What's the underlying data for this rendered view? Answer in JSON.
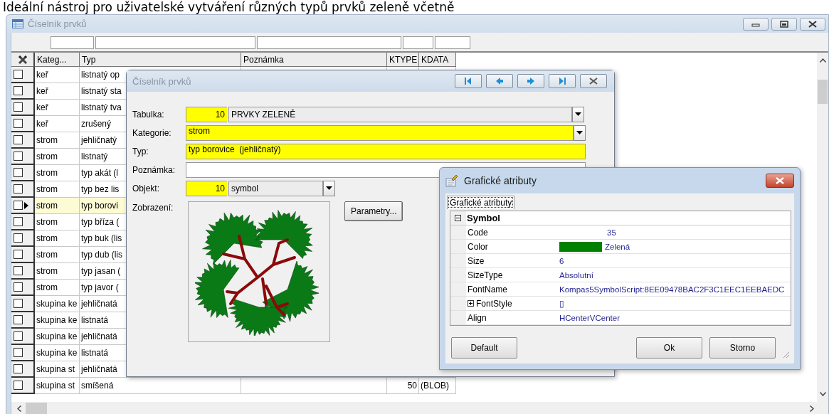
{
  "caption": "Ideální nástroj pro uživatelské vytváření různých typů prvků zeleně včetně",
  "main_window": {
    "title": "Číselník prvků",
    "table": {
      "columns": [
        "Kateg...",
        "Typ",
        "Poznámka",
        "KTYPE",
        "KDATA"
      ],
      "rows": [
        {
          "checked": false,
          "selected": false,
          "kategorie": "keř",
          "typ": "listnatý op"
        },
        {
          "checked": false,
          "selected": false,
          "kategorie": "keř",
          "typ": "listnatý sta"
        },
        {
          "checked": false,
          "selected": false,
          "kategorie": "keř",
          "typ": "listnatý tva"
        },
        {
          "checked": false,
          "selected": false,
          "kategorie": "keř",
          "typ": "zrušený"
        },
        {
          "checked": false,
          "selected": false,
          "kategorie": "strom",
          "typ": "jehličnatý"
        },
        {
          "checked": false,
          "selected": false,
          "kategorie": "strom",
          "typ": "listnatý"
        },
        {
          "checked": false,
          "selected": false,
          "kategorie": "strom",
          "typ": "typ akát (l"
        },
        {
          "checked": false,
          "selected": false,
          "kategorie": "strom",
          "typ": "typ bez lis"
        },
        {
          "checked": false,
          "selected": true,
          "kategorie": "strom",
          "typ": "typ borovi"
        },
        {
          "checked": false,
          "selected": false,
          "kategorie": "strom",
          "typ": "typ bříza ("
        },
        {
          "checked": false,
          "selected": false,
          "kategorie": "strom",
          "typ": "typ buk (lis"
        },
        {
          "checked": false,
          "selected": false,
          "kategorie": "strom",
          "typ": "typ dub (lis"
        },
        {
          "checked": false,
          "selected": false,
          "kategorie": "strom",
          "typ": "typ jasan ("
        },
        {
          "checked": false,
          "selected": false,
          "kategorie": "strom",
          "typ": "typ javor ("
        },
        {
          "checked": false,
          "selected": false,
          "kategorie": "skupina ke",
          "typ": "jehličnatá"
        },
        {
          "checked": false,
          "selected": false,
          "kategorie": "skupina ke",
          "typ": "listnatá"
        },
        {
          "checked": false,
          "selected": false,
          "kategorie": "skupina ke",
          "typ": "jehličnatá"
        },
        {
          "checked": false,
          "selected": false,
          "kategorie": "skupina ke",
          "typ": "listnatá"
        },
        {
          "checked": false,
          "selected": false,
          "kategorie": "skupina st",
          "typ": "jehličnatá"
        },
        {
          "checked": false,
          "selected": false,
          "kategorie": "skupina st",
          "typ": "smíšená",
          "ktype": "50",
          "kdata": "(BLOB)"
        }
      ]
    }
  },
  "record_dialog": {
    "title": "Číselník prvků",
    "fields": [
      {
        "kind": "code_combo",
        "label": "Tabulka:",
        "code": "10",
        "value": "PRVKY ZELENĚ",
        "wide": true
      },
      {
        "kind": "combo",
        "label": "Kategorie:",
        "value": "strom",
        "required": true
      },
      {
        "kind": "text",
        "label": "Typ:",
        "value": "typ borovice  (jehličnatý)",
        "required": true
      },
      {
        "kind": "text",
        "label": "Poznámka:",
        "required": false
      },
      {
        "kind": "code_combo",
        "label": "Objekt:",
        "code": "10",
        "value": "symbol",
        "wide": false
      }
    ],
    "preview_label": "Zobrazení:",
    "parameters_button": "Parametry..."
  },
  "attributes_dialog": {
    "title": "Grafické atributy",
    "tabs": [
      {
        "label": "Grafické atributy",
        "selected": true
      }
    ],
    "category": {
      "name": "Symbol",
      "expanded": true,
      "properties": [
        {
          "kind": "number",
          "name": "Code",
          "value": "35"
        },
        {
          "kind": "color",
          "name": "Color",
          "value": "Zelená",
          "color": "#008000"
        },
        {
          "kind": "plain",
          "name": "Size",
          "value": "6"
        },
        {
          "kind": "plain",
          "name": "SizeType",
          "value": "Absolutní"
        },
        {
          "kind": "plain",
          "name": "FontName",
          "value": "Kompas5SymbolScript:8EE09478BAC2F3C1EEC1EEBAEDC"
        },
        {
          "kind": "group",
          "name": "FontStyle",
          "value": "▯",
          "expanded": false
        },
        {
          "kind": "plain",
          "name": "Align",
          "value": "HCenterVCenter"
        }
      ]
    },
    "buttons": [
      "Default",
      "Ok",
      "Storno"
    ]
  }
}
